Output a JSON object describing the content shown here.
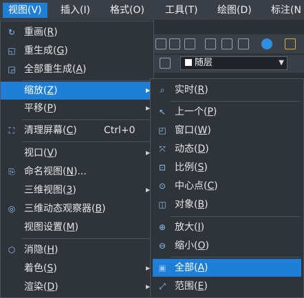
{
  "menubar": [
    {
      "label": "视图(V)",
      "active": true
    },
    {
      "label": "插入(I)"
    },
    {
      "label": "格式(O)"
    },
    {
      "label": "工具(T)"
    },
    {
      "label": "绘图(D)"
    },
    {
      "label": "标注(N"
    }
  ],
  "toolbar": {
    "layer_value": "随层",
    "combo_arrow": "▼"
  },
  "view_menu": {
    "items": [
      {
        "icon": "redraw-icon",
        "glyph": "↻",
        "label": "重画(",
        "key": "R",
        "end": ")"
      },
      {
        "icon": "regen-icon",
        "glyph": "◱",
        "label": "重生成(",
        "key": "G",
        "end": ")"
      },
      {
        "icon": "regen-all-icon",
        "glyph": "◲",
        "label": "全部重生成(",
        "key": "A",
        "end": ")"
      },
      {
        "label": "缩放(",
        "key": "Z",
        "end": ")",
        "arrow": "▶"
      },
      {
        "label": "平移(",
        "key": "P",
        "end": ")",
        "arrow": "▶"
      },
      {
        "icon": "clean-screen-icon",
        "glyph": "⛶",
        "label": "清理屏幕(",
        "key": "C",
        "end": ")",
        "shortcut": "Ctrl+0"
      },
      {
        "label": "视口(",
        "key": "V",
        "end": ")",
        "arrow": "▶"
      },
      {
        "icon": "named-view-icon",
        "glyph": "⎘",
        "label": "命名视图(",
        "key": "N",
        "end": ")..."
      },
      {
        "label": "三维视图(",
        "key": "3",
        "end": ")",
        "arrow": "▶"
      },
      {
        "icon": "orbit-icon",
        "glyph": "◎",
        "label": "三维动态观察器(",
        "key": "B",
        "end": ")"
      },
      {
        "label": "视图设置(",
        "key": "M",
        "end": ")"
      },
      {
        "icon": "hide-icon",
        "glyph": "⬡",
        "label": "消隐(",
        "key": "H",
        "end": ")"
      },
      {
        "label": "着色(",
        "key": "S",
        "end": ")",
        "arrow": "▶"
      },
      {
        "label": "渲染(",
        "key": "D",
        "end": ")",
        "arrow": "▶"
      }
    ]
  },
  "zoom_menu": {
    "items": [
      {
        "icon": "zoom-realtime-icon",
        "glyph": "⌕",
        "label": "实时(",
        "key": "R",
        "end": ")"
      },
      {
        "icon": "zoom-previous-icon",
        "glyph": "↖",
        "label": "上一个(",
        "key": "P",
        "end": ")"
      },
      {
        "icon": "zoom-window-icon",
        "glyph": "◰",
        "label": "窗口(",
        "key": "W",
        "end": ")"
      },
      {
        "icon": "zoom-dynamic-icon",
        "glyph": "⤧",
        "label": "动态(",
        "key": "D",
        "end": ")"
      },
      {
        "icon": "zoom-scale-icon",
        "glyph": "⊡",
        "label": "比例(",
        "key": "S",
        "end": ")"
      },
      {
        "icon": "zoom-center-icon",
        "glyph": "⊙",
        "label": "中心点(",
        "key": "C",
        "end": ")"
      },
      {
        "icon": "zoom-object-icon",
        "glyph": "◫",
        "label": "对象(",
        "key": "B",
        "end": ")"
      },
      {
        "icon": "zoom-in-icon",
        "glyph": "⊕",
        "label": "放大(",
        "key": "I",
        "end": ")"
      },
      {
        "icon": "zoom-out-icon",
        "glyph": "⊖",
        "label": "缩小(",
        "key": "O",
        "end": ")"
      },
      {
        "icon": "zoom-all-icon",
        "glyph": "▣",
        "label": "全部(",
        "key": "A",
        "end": ")"
      },
      {
        "icon": "zoom-extents-icon",
        "glyph": "⤢",
        "label": "范围(",
        "key": "E",
        "end": ")"
      }
    ]
  }
}
